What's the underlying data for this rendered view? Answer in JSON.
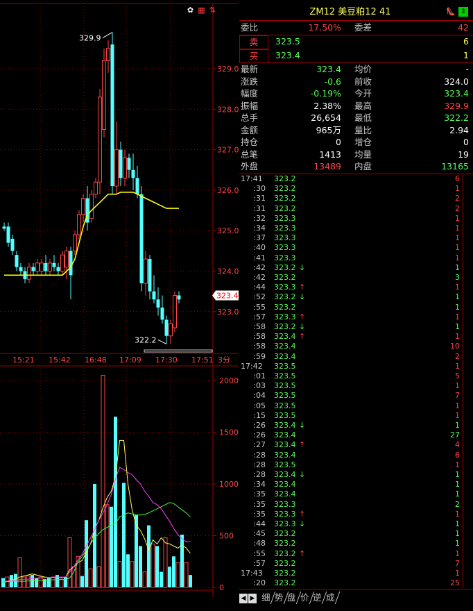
{
  "toolbar_icons": [
    {
      "name": "settings-icon",
      "glyph": "✿",
      "color": "#ffffff"
    },
    {
      "name": "card-icon",
      "glyph": "▦",
      "color": "#ff4040"
    },
    {
      "name": "sort-icon",
      "glyph": "⇅",
      "color": "#ff4040"
    }
  ],
  "quote": {
    "title": "ZM12  美豆粕12  41",
    "weibi_label": "委比",
    "weibi_value": "17.50%",
    "weicha_label": "委差",
    "weicha_value": "42",
    "sell_label": "卖",
    "sell_price": "323.5",
    "sell_vol": "6",
    "buy_label": "买",
    "buy_price": "323.4",
    "buy_vol": "1",
    "stats_left": [
      {
        "label": "最新",
        "value": "323.4",
        "color": "#54ff54"
      },
      {
        "label": "涨跌",
        "value": "-0.6",
        "color": "#54ff54"
      },
      {
        "label": "幅度",
        "value": "-0.19%",
        "color": "#54ff54"
      },
      {
        "label": "振幅",
        "value": "2.38%",
        "color": "#ffffff"
      },
      {
        "label": "总手",
        "value": "26,654",
        "color": "#ffffff"
      },
      {
        "label": "金额",
        "value": "965万",
        "color": "#ffffff"
      },
      {
        "label": "持仓",
        "value": "0",
        "color": "#ffffff"
      },
      {
        "label": "总笔",
        "value": "1413",
        "color": "#ffffff"
      },
      {
        "label": "外盘",
        "value": "13489",
        "color": "#ff4444"
      }
    ],
    "stats_right": [
      {
        "label": "均价",
        "value": "-",
        "color": "#ffffff"
      },
      {
        "label": "前收",
        "value": "324.0",
        "color": "#ffffff"
      },
      {
        "label": "今开",
        "value": "323.4",
        "color": "#54ff54"
      },
      {
        "label": "最高",
        "value": "329.9",
        "color": "#ff4444"
      },
      {
        "label": "最低",
        "value": "322.2",
        "color": "#54ff54"
      },
      {
        "label": "量比",
        "value": "2.94",
        "color": "#ffffff"
      },
      {
        "label": "增仓",
        "value": "0",
        "color": "#ffffff"
      },
      {
        "label": "均量",
        "value": "19",
        "color": "#ffffff"
      },
      {
        "label": "内盘",
        "value": "13165",
        "color": "#54ff54"
      }
    ]
  },
  "ticks": [
    {
      "time": "17:41",
      "price": "323.2",
      "arrow": "",
      "vol": "6",
      "vc": "#ff4444"
    },
    {
      "time": ":30",
      "price": "323.2",
      "arrow": "",
      "vol": "1",
      "vc": "#ff4444"
    },
    {
      "time": ":31",
      "price": "323.2",
      "arrow": "",
      "vol": "2",
      "vc": "#ff4444"
    },
    {
      "time": ":31",
      "price": "323.2",
      "arrow": "",
      "vol": "2",
      "vc": "#ff4444"
    },
    {
      "time": ":32",
      "price": "323.3",
      "arrow": "",
      "vol": "1",
      "vc": "#ff4444"
    },
    {
      "time": ":34",
      "price": "323.3",
      "arrow": "",
      "vol": "1",
      "vc": "#ff4444"
    },
    {
      "time": ":37",
      "price": "323.3",
      "arrow": "",
      "vol": "1",
      "vc": "#ff4444"
    },
    {
      "time": ":40",
      "price": "323.3",
      "arrow": "",
      "vol": "1",
      "vc": "#ff4444"
    },
    {
      "time": ":41",
      "price": "323.3",
      "arrow": "",
      "vol": "1",
      "vc": "#ff4444"
    },
    {
      "time": ":42",
      "price": "323.2",
      "arrow": "↓",
      "vol": "1",
      "vc": "#54ff54"
    },
    {
      "time": ":42",
      "price": "323.2",
      "arrow": "",
      "vol": "3",
      "vc": "#54ff54"
    },
    {
      "time": ":44",
      "price": "323.3",
      "arrow": "↑",
      "vol": "1",
      "vc": "#ff4444"
    },
    {
      "time": ":52",
      "price": "323.2",
      "arrow": "↓",
      "vol": "1",
      "vc": "#54ff54"
    },
    {
      "time": ":55",
      "price": "323.2",
      "arrow": "",
      "vol": "1",
      "vc": "#54ff54"
    },
    {
      "time": ":57",
      "price": "323.3",
      "arrow": "↑",
      "vol": "1",
      "vc": "#ff4444"
    },
    {
      "time": ":58",
      "price": "323.2",
      "arrow": "↓",
      "vol": "1",
      "vc": "#54ff54"
    },
    {
      "time": ":58",
      "price": "323.4",
      "arrow": "↑",
      "vol": "1",
      "vc": "#ff4444"
    },
    {
      "time": ":58",
      "price": "323.4",
      "arrow": "",
      "vol": "10",
      "vc": "#ff4444"
    },
    {
      "time": ":59",
      "price": "323.4",
      "arrow": "",
      "vol": "2",
      "vc": "#ff4444"
    },
    {
      "time": "17:42",
      "price": "323.5",
      "arrow": "",
      "vol": "1",
      "vc": "#ff4444"
    },
    {
      "time": ":01",
      "price": "323.5",
      "arrow": "",
      "vol": "5",
      "vc": "#ff4444"
    },
    {
      "time": ":03",
      "price": "323.5",
      "arrow": "",
      "vol": "1",
      "vc": "#ff4444"
    },
    {
      "time": ":04",
      "price": "323.5",
      "arrow": "",
      "vol": "7",
      "vc": "#ff4444"
    },
    {
      "time": ":05",
      "price": "323.5",
      "arrow": "",
      "vol": "1",
      "vc": "#ff4444"
    },
    {
      "time": ":15",
      "price": "323.5",
      "arrow": "",
      "vol": "1",
      "vc": "#ff4444"
    },
    {
      "time": ":26",
      "price": "323.4",
      "arrow": "↓",
      "vol": "1",
      "vc": "#54ff54"
    },
    {
      "time": ":26",
      "price": "323.4",
      "arrow": "",
      "vol": "27",
      "vc": "#54ff54"
    },
    {
      "time": ":27",
      "price": "323.4",
      "arrow": "↑",
      "vol": "4",
      "vc": "#ff4444"
    },
    {
      "time": ":28",
      "price": "323.4",
      "arrow": "",
      "vol": "6",
      "vc": "#ff4444"
    },
    {
      "time": ":28",
      "price": "323.5",
      "arrow": "",
      "vol": "1",
      "vc": "#ff4444"
    },
    {
      "time": ":28",
      "price": "323.4",
      "arrow": "↓",
      "vol": "1",
      "vc": "#54ff54"
    },
    {
      "time": ":34",
      "price": "323.4",
      "arrow": "",
      "vol": "1",
      "vc": "#54ff54"
    },
    {
      "time": ":35",
      "price": "323.4",
      "arrow": "",
      "vol": "1",
      "vc": "#54ff54"
    },
    {
      "time": ":35",
      "price": "323.3",
      "arrow": "",
      "vol": "2",
      "vc": "#54ff54"
    },
    {
      "time": ":35",
      "price": "323.3",
      "arrow": "↑",
      "vol": "1",
      "vc": "#ff4444"
    },
    {
      "time": ":44",
      "price": "323.3",
      "arrow": "↓",
      "vol": "1",
      "vc": "#54ff54"
    },
    {
      "time": ":45",
      "price": "323.2",
      "arrow": "",
      "vol": "1",
      "vc": "#54ff54"
    },
    {
      "time": ":48",
      "price": "323.2",
      "arrow": "",
      "vol": "1",
      "vc": "#54ff54"
    },
    {
      "time": ":55",
      "price": "323.2",
      "arrow": "↑",
      "vol": "1",
      "vc": "#ff4444"
    },
    {
      "time": ":57",
      "price": "323.2",
      "arrow": "",
      "vol": "7",
      "vc": "#ff4444"
    },
    {
      "time": "17:43",
      "price": "323.2",
      "arrow": "",
      "vol": "1",
      "vc": "#ff4444"
    },
    {
      "time": ":20",
      "price": "323.2",
      "arrow": "",
      "vol": "25",
      "vc": "#ff4444"
    }
  ],
  "tabs": [
    "细",
    "势",
    "盘",
    "价",
    "逆",
    "成"
  ],
  "tab_nav": {
    "prev": "◀",
    "next": "▶"
  },
  "chart_data": [
    {
      "type": "candlestick",
      "period_label": "3分",
      "x_tick_labels": [
        "15:21",
        "15:42",
        "16:48",
        "17:09",
        "17:30",
        "17:51"
      ],
      "y_tick_labels": [
        "323.0",
        "324.0",
        "325.0",
        "326.0",
        "327.0",
        "328.0",
        "329.0"
      ],
      "ylim": [
        322.0,
        329.8
      ],
      "last_price": "323.4",
      "high_label": "329.9",
      "low_label": "322.2",
      "candles": [
        {
          "o": 325.1,
          "h": 325.2,
          "l": 325.0,
          "c": 325.05
        },
        {
          "o": 325.1,
          "h": 325.2,
          "l": 324.6,
          "c": 324.7
        },
        {
          "o": 324.8,
          "h": 324.9,
          "l": 324.4,
          "c": 324.5
        },
        {
          "o": 324.4,
          "h": 324.5,
          "l": 324.0,
          "c": 324.1
        },
        {
          "o": 324.1,
          "h": 324.2,
          "l": 323.9,
          "c": 324.0
        },
        {
          "o": 324.0,
          "h": 324.1,
          "l": 323.7,
          "c": 323.8
        },
        {
          "o": 323.8,
          "h": 324.2,
          "l": 323.7,
          "c": 324.1
        },
        {
          "o": 324.1,
          "h": 324.2,
          "l": 323.9,
          "c": 324.0
        },
        {
          "o": 324.0,
          "h": 324.3,
          "l": 323.9,
          "c": 324.2
        },
        {
          "o": 324.0,
          "h": 324.3,
          "l": 323.9,
          "c": 324.2
        },
        {
          "o": 324.2,
          "h": 324.4,
          "l": 323.9,
          "c": 324.0
        },
        {
          "o": 324.0,
          "h": 324.3,
          "l": 323.9,
          "c": 324.2
        },
        {
          "o": 324.2,
          "h": 324.4,
          "l": 324.0,
          "c": 324.1
        },
        {
          "o": 324.1,
          "h": 324.2,
          "l": 323.9,
          "c": 324.0
        },
        {
          "o": 324.0,
          "h": 324.5,
          "l": 323.9,
          "c": 324.4
        },
        {
          "o": 324.1,
          "h": 324.6,
          "l": 323.8,
          "c": 324.5
        },
        {
          "o": 324.5,
          "h": 324.6,
          "l": 323.3,
          "c": 323.9
        },
        {
          "o": 324.5,
          "h": 325.0,
          "l": 324.4,
          "c": 324.9
        },
        {
          "o": 324.9,
          "h": 325.5,
          "l": 324.8,
          "c": 325.4
        },
        {
          "o": 325.4,
          "h": 325.9,
          "l": 325.2,
          "c": 325.8
        },
        {
          "o": 325.8,
          "h": 326.1,
          "l": 325.0,
          "c": 325.2
        },
        {
          "o": 325.3,
          "h": 326.0,
          "l": 325.2,
          "c": 325.9
        },
        {
          "o": 325.9,
          "h": 326.3,
          "l": 325.8,
          "c": 326.2
        },
        {
          "o": 326.2,
          "h": 328.5,
          "l": 325.9,
          "c": 328.3
        },
        {
          "o": 327.5,
          "h": 329.5,
          "l": 327.3,
          "c": 329.2
        },
        {
          "o": 329.2,
          "h": 329.7,
          "l": 328.9,
          "c": 329.5
        },
        {
          "o": 329.6,
          "h": 329.9,
          "l": 325.9,
          "c": 326.1
        },
        {
          "o": 326.1,
          "h": 327.7,
          "l": 325.9,
          "c": 327.0
        },
        {
          "o": 327.0,
          "h": 327.2,
          "l": 326.1,
          "c": 326.3
        },
        {
          "o": 326.3,
          "h": 327.0,
          "l": 326.1,
          "c": 326.8
        },
        {
          "o": 326.8,
          "h": 326.9,
          "l": 326.3,
          "c": 326.5
        },
        {
          "o": 326.5,
          "h": 326.9,
          "l": 326.0,
          "c": 326.3
        },
        {
          "o": 326.3,
          "h": 326.6,
          "l": 325.8,
          "c": 325.9
        },
        {
          "o": 325.9,
          "h": 326.1,
          "l": 323.5,
          "c": 323.7
        },
        {
          "o": 323.7,
          "h": 324.5,
          "l": 323.4,
          "c": 324.3
        },
        {
          "o": 324.3,
          "h": 324.4,
          "l": 323.3,
          "c": 323.5
        },
        {
          "o": 323.5,
          "h": 323.9,
          "l": 323.2,
          "c": 323.3
        },
        {
          "o": 323.3,
          "h": 323.6,
          "l": 322.9,
          "c": 323.1
        },
        {
          "o": 323.1,
          "h": 323.4,
          "l": 322.7,
          "c": 322.8
        },
        {
          "o": 322.8,
          "h": 322.9,
          "l": 322.2,
          "c": 322.4
        },
        {
          "o": 322.4,
          "h": 322.8,
          "l": 322.2,
          "c": 322.7
        },
        {
          "o": 322.6,
          "h": 323.5,
          "l": 322.5,
          "c": 323.4
        },
        {
          "o": 323.4,
          "h": 323.5,
          "l": 323.2,
          "c": 323.3
        }
      ],
      "ma": [
        323.9,
        323.9,
        323.9,
        323.9,
        323.9,
        323.9,
        323.9,
        323.9,
        323.9,
        323.9,
        323.9,
        323.9,
        323.9,
        323.9,
        323.9,
        324.0,
        324.1,
        324.3,
        324.7,
        325.1,
        325.4,
        325.5,
        325.6,
        325.7,
        325.8,
        325.9,
        325.9,
        325.9,
        325.95,
        325.95,
        325.95,
        325.95,
        325.9,
        325.85,
        325.8,
        325.75,
        325.7,
        325.65,
        325.6,
        325.55,
        325.55,
        325.55,
        325.55
      ]
    },
    {
      "type": "bar",
      "y_tick_labels": [
        "0",
        "500",
        "1000",
        "1500",
        "2000"
      ],
      "ylim": [
        0,
        2000
      ],
      "values": [
        90,
        100,
        120,
        130,
        290,
        100,
        110,
        120,
        90,
        100,
        80,
        90,
        100,
        120,
        80,
        100,
        480,
        200,
        300,
        110,
        650,
        180,
        1000,
        200,
        2050,
        800,
        780,
        1650,
        250,
        1010,
        320,
        250,
        700,
        400,
        150,
        600,
        420,
        400,
        150,
        480,
        200,
        300,
        240,
        510,
        240,
        120
      ],
      "up": [
        false,
        true,
        false,
        false,
        true,
        true,
        true,
        false,
        false,
        true,
        false,
        false,
        true,
        false,
        true,
        false,
        true,
        true,
        true,
        false,
        false,
        true,
        false,
        true,
        true,
        true,
        false,
        false,
        true,
        false,
        false,
        true,
        false,
        false,
        true,
        false,
        true,
        false,
        false,
        true,
        false,
        false,
        true,
        false,
        true,
        false
      ],
      "series": [
        {
          "color": "#ffff54",
          "values": [
            50,
            60,
            70,
            80,
            100,
            110,
            120,
            130,
            120,
            110,
            100,
            95,
            95,
            100,
            95,
            100,
            170,
            200,
            240,
            260,
            340,
            420,
            560,
            650,
            770,
            870,
            930,
            1070,
            1420,
            1420,
            1000,
            750,
            600,
            550,
            470,
            360,
            460,
            420,
            480,
            430,
            420,
            400,
            380,
            410,
            380,
            330
          ]
        },
        {
          "color": "#ff40ff",
          "values": [
            60,
            60,
            65,
            70,
            75,
            80,
            80,
            85,
            90,
            90,
            95,
            95,
            100,
            100,
            100,
            100,
            150,
            200,
            270,
            320,
            400,
            480,
            560,
            650,
            720,
            800,
            900,
            1050,
            1160,
            1140,
            1110,
            1090,
            1040,
            1000,
            930,
            880,
            820,
            800,
            760,
            700,
            640,
            570,
            510,
            470,
            440,
            440
          ]
        },
        {
          "color": "#40ff40",
          "values": [
            50,
            55,
            60,
            60,
            60,
            60,
            62,
            63,
            65,
            68,
            70,
            72,
            73,
            75,
            76,
            77,
            90,
            150,
            250,
            300,
            360,
            420,
            480,
            520,
            560,
            580,
            600,
            620,
            680,
            700,
            720,
            710,
            700,
            700,
            705,
            720,
            740,
            760,
            780,
            800,
            820,
            810,
            780,
            750,
            720,
            680
          ]
        }
      ]
    }
  ]
}
